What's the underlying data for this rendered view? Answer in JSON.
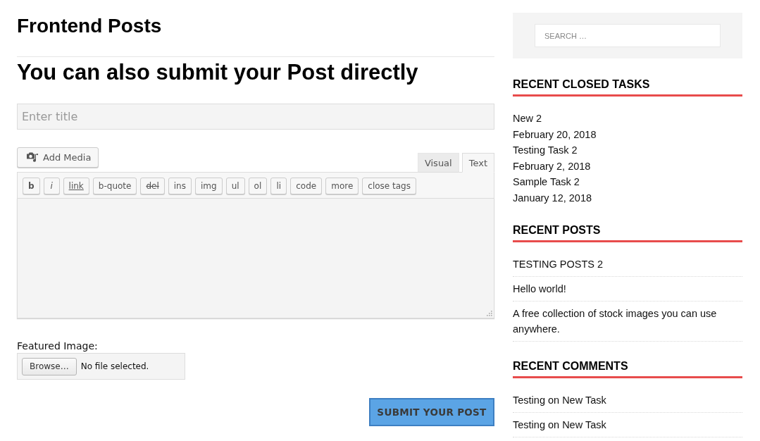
{
  "page_title": "Frontend Posts",
  "form": {
    "heading": "You can also submit your Post directly",
    "title_field": {
      "placeholder": "Enter title"
    },
    "add_media_button": "Add Media",
    "editor_tabs": [
      {
        "label": "Visual",
        "selected": false
      },
      {
        "label": "Text",
        "selected": true
      }
    ],
    "quicktags": [
      {
        "label": "b",
        "kind": "bold"
      },
      {
        "label": "i",
        "kind": "italic"
      },
      {
        "label": "link",
        "kind": "underline"
      },
      {
        "label": "b-quote",
        "kind": "plain"
      },
      {
        "label": "del",
        "kind": "strike"
      },
      {
        "label": "ins",
        "kind": "plain"
      },
      {
        "label": "img",
        "kind": "plain"
      },
      {
        "label": "ul",
        "kind": "plain"
      },
      {
        "label": "ol",
        "kind": "plain"
      },
      {
        "label": "li",
        "kind": "plain"
      },
      {
        "label": "code",
        "kind": "plain"
      },
      {
        "label": "more",
        "kind": "plain"
      },
      {
        "label": "close tags",
        "kind": "plain"
      }
    ],
    "featured_image": {
      "label": "Featured Image:",
      "button": "Browse…",
      "status": "No file selected."
    },
    "submit_button": "SUBMIT YOUR POST"
  },
  "sidebar": {
    "search": {
      "placeholder": "SEARCH …"
    },
    "widgets": [
      {
        "title": "RECENT CLOSED TASKS",
        "kind": "dated",
        "items": [
          {
            "title": "New 2",
            "date": "February 20, 2018"
          },
          {
            "title": "Testing Task 2",
            "date": "February 2, 2018"
          },
          {
            "title": "Sample Task 2",
            "date": "January 12, 2018"
          }
        ]
      },
      {
        "title": "RECENT POSTS",
        "kind": "divided",
        "items": [
          {
            "title": "TESTING POSTS 2"
          },
          {
            "title": "Hello world!"
          },
          {
            "title": "A free collection of stock images you can use anywhere."
          }
        ]
      },
      {
        "title": "RECENT COMMENTS",
        "kind": "divided",
        "items": [
          {
            "title": "Testing on New Task"
          },
          {
            "title": "Testing on New Task"
          }
        ]
      }
    ]
  }
}
